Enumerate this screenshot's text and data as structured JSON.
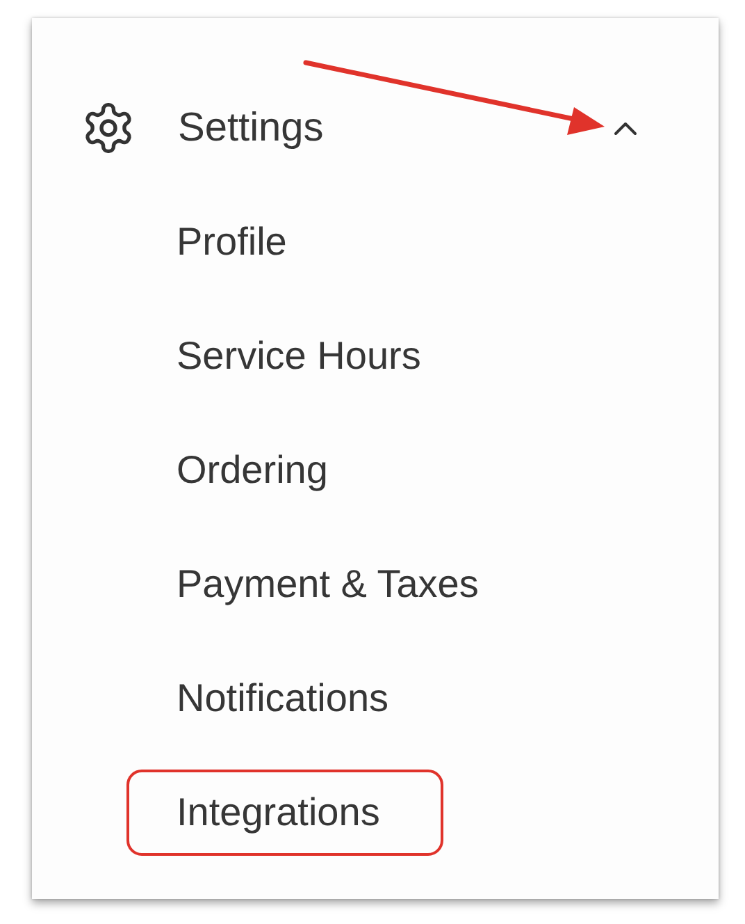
{
  "menu": {
    "title": "Settings",
    "expanded": true,
    "pointer_arrow": true,
    "items": [
      {
        "label": "Profile",
        "highlighted": false
      },
      {
        "label": "Service Hours",
        "highlighted": false
      },
      {
        "label": "Ordering",
        "highlighted": false
      },
      {
        "label": "Payment & Taxes",
        "highlighted": false
      },
      {
        "label": "Notifications",
        "highlighted": false
      },
      {
        "label": "Integrations",
        "highlighted": true
      }
    ]
  }
}
